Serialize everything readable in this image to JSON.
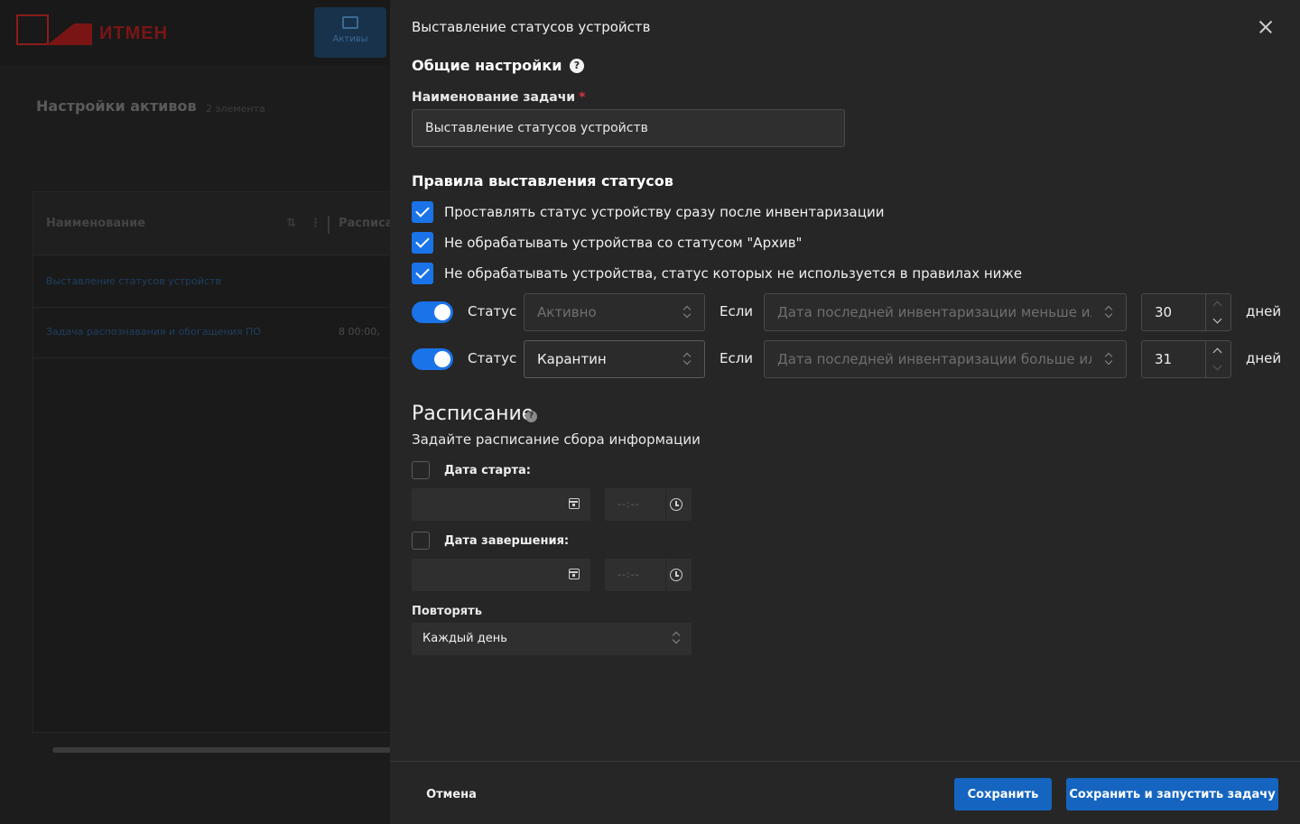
{
  "background": {
    "logo_text": "ИТМЕН",
    "nav_tab_label": "Активы",
    "page_title": "Настройки активов",
    "page_count": "2 элемента",
    "table_headers": [
      "Наименование",
      "Расписа"
    ],
    "rows": [
      {
        "name": "Выставление статусов устройств",
        "schedule": ""
      },
      {
        "name": "Задача распознавания и обогащения ПО",
        "schedule": "8 00:00,"
      }
    ]
  },
  "drawer": {
    "title": "Выставление статусов устройств",
    "general_heading": "Общие настройки",
    "help_glyph": "?",
    "task_name_label": "Наименование задачи",
    "required_mark": "*",
    "task_name_value": "Выставление статусов устройств",
    "rules_heading": "Правила выставления статусов",
    "checkboxes": [
      {
        "label": "Проставлять статус устройству сразу после инвентаризации",
        "checked": true
      },
      {
        "label": "Не обрабатывать устройства со статусом \"Архив\"",
        "checked": true
      },
      {
        "label": "Не обрабатывать устройства, статус которых не используется в правилах ниже",
        "checked": true
      }
    ],
    "rules": [
      {
        "enabled": true,
        "status_label": "Статус",
        "status_value": "Активно",
        "status_disabled": true,
        "if_label": "Если",
        "condition_value": "Дата последней инвентаризации меньше или равна",
        "days_value": "30",
        "days_label": "дней"
      },
      {
        "enabled": true,
        "status_label": "Статус",
        "status_value": "Карантин",
        "status_disabled": false,
        "if_label": "Если",
        "condition_value": "Дата последней инвентаризации больше или равна",
        "days_value": "31",
        "days_label": "дней"
      }
    ],
    "schedule": {
      "heading": "Расписание",
      "subtitle": "Задайте расписание сбора информации",
      "start_label": "Дата старта:",
      "end_label": "Дата завершения:",
      "time_placeholder": "--:--",
      "repeat_label": "Повторять",
      "repeat_value": "Каждый день"
    },
    "footer": {
      "cancel": "Отмена",
      "save": "Сохранить",
      "save_and_run": "Сохранить и запустить задачу"
    }
  },
  "colors": {
    "accent": "#1a73e8",
    "primary_button": "#1565c0",
    "required": "#d9363e",
    "drawer_bg": "#262626"
  }
}
